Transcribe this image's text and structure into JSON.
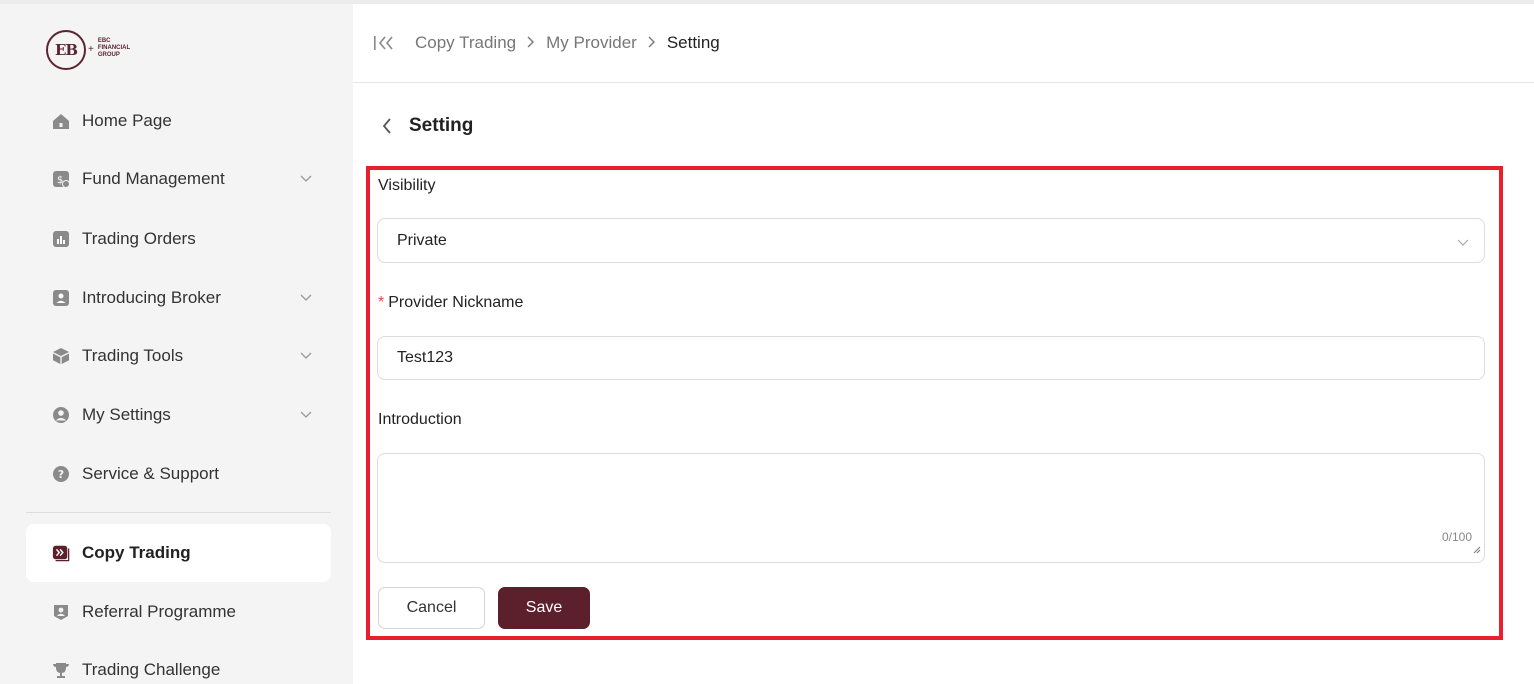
{
  "brand": {
    "logo_text": [
      "EBC",
      "FINANCIAL",
      "GROUP"
    ]
  },
  "sidebar": {
    "items": [
      {
        "label": "Home Page",
        "icon": "home-icon",
        "has_submenu": false,
        "active": false
      },
      {
        "label": "Fund Management",
        "icon": "fund-icon",
        "has_submenu": true,
        "active": false
      },
      {
        "label": "Trading Orders",
        "icon": "chart-icon",
        "has_submenu": false,
        "active": false
      },
      {
        "label": "Introducing Broker",
        "icon": "broker-icon",
        "has_submenu": true,
        "active": false
      },
      {
        "label": "Trading Tools",
        "icon": "box-icon",
        "has_submenu": true,
        "active": false
      },
      {
        "label": "My Settings",
        "icon": "user-circle-icon",
        "has_submenu": true,
        "active": false
      },
      {
        "label": "Service & Support",
        "icon": "help-icon",
        "has_submenu": false,
        "active": false
      },
      {
        "label": "Copy Trading",
        "icon": "copy-trading-icon",
        "has_submenu": false,
        "active": true
      },
      {
        "label": "Referral Programme",
        "icon": "referral-icon",
        "has_submenu": false,
        "active": false
      },
      {
        "label": "Trading Challenge",
        "icon": "trophy-icon",
        "has_submenu": false,
        "active": false
      }
    ]
  },
  "header": {
    "breadcrumb": [
      "Copy Trading",
      "My Provider",
      "Setting"
    ]
  },
  "page": {
    "title": "Setting"
  },
  "form": {
    "visibility_label": "Visibility",
    "visibility_value": "Private",
    "nickname_required_mark": "*",
    "nickname_label": "Provider Nickname",
    "nickname_value": "Test123",
    "introduction_label": "Introduction",
    "introduction_value": "",
    "introduction_counter": "0/100",
    "cancel_label": "Cancel",
    "save_label": "Save"
  },
  "colors": {
    "accent": "#5c1f2c",
    "highlight_frame": "#e8202e",
    "sidebar_bg": "#f4f4f5",
    "icon_gray": "#8a8a8a"
  }
}
